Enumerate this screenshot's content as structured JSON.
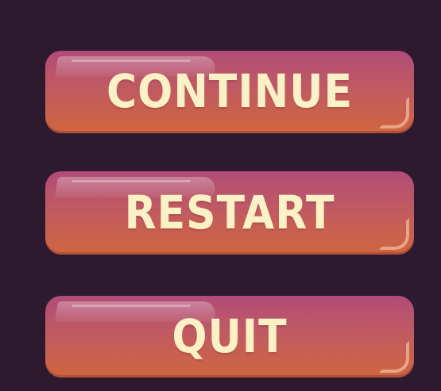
{
  "pause_menu": {
    "buttons": [
      {
        "id": "continue",
        "label": "CONTINUE"
      },
      {
        "id": "restart",
        "label": "RESTART"
      },
      {
        "id": "quit",
        "label": "QUIT"
      }
    ]
  },
  "colors": {
    "background": "#2e1a2e",
    "button_top": "#b04c78",
    "button_bottom": "#d0663e",
    "label": "#fbf1c7"
  }
}
